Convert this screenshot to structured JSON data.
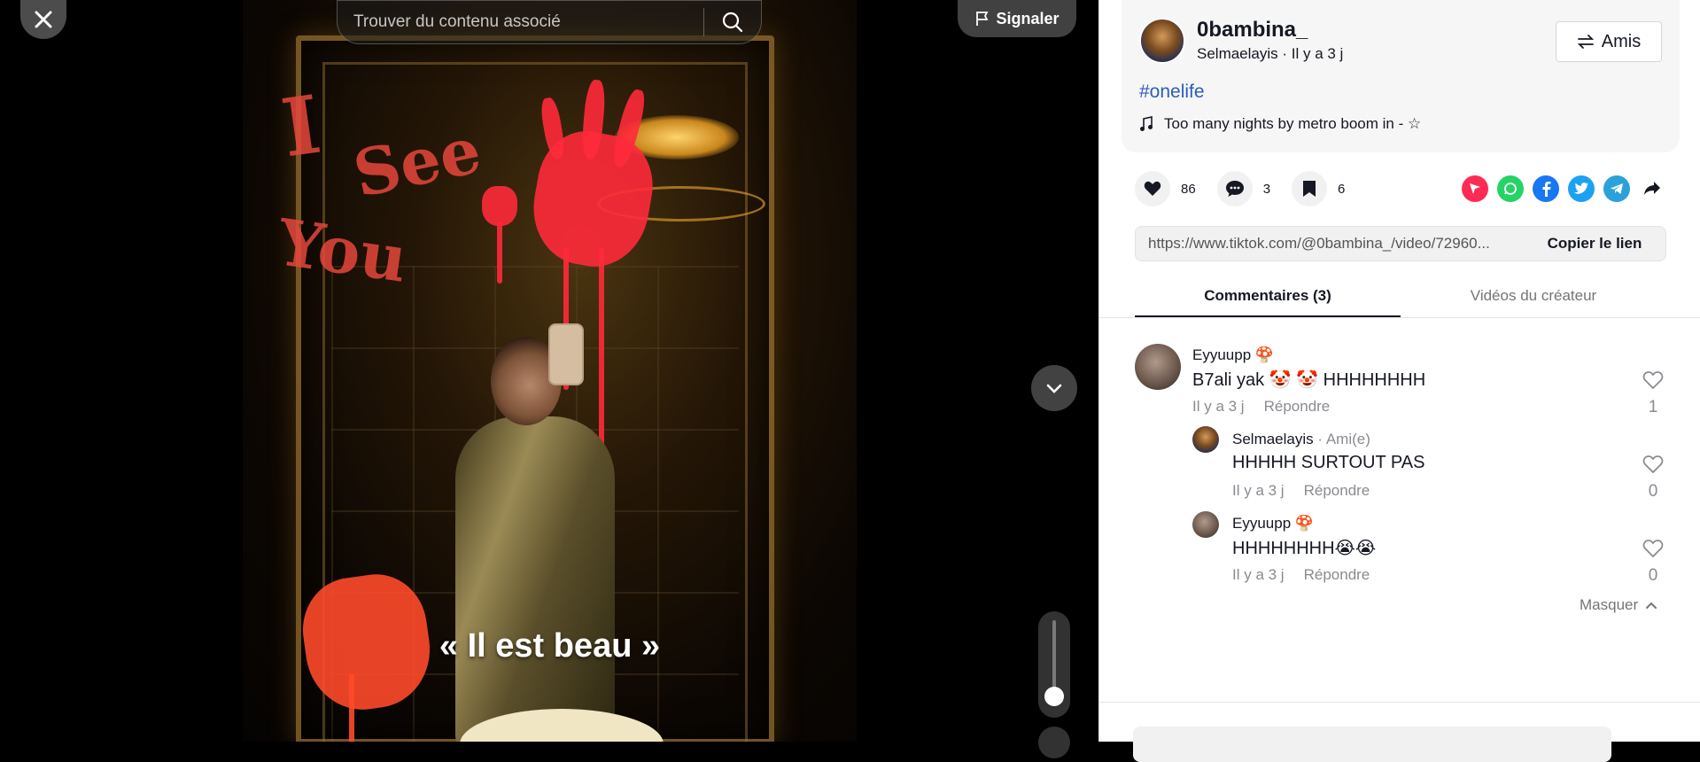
{
  "player": {
    "search_placeholder": "Trouver du contenu associé",
    "report_label": "Signaler",
    "caption": "« Il est beau »",
    "volume_level": 0.05
  },
  "author": {
    "name": "0bambina_",
    "subtitle": "Selmaelayis · Il y a 3 j",
    "friends_label": "Amis",
    "hashtag": "#onelife",
    "music": "Too many nights by metro boom in - ☆"
  },
  "actions": {
    "likes": "86",
    "comments": "3",
    "saves": "6"
  },
  "share_colors": {
    "repost": "#fe2c55",
    "whatsapp": "#25d366",
    "facebook": "#1877f2",
    "twitter": "#1da1f2",
    "telegram": "#2aa1da"
  },
  "link": {
    "url": "https://www.tiktok.com/@0bambina_/video/72960...",
    "copy_label": "Copier le lien"
  },
  "tabs": {
    "comments": "Commentaires (3)",
    "creator_videos": "Vidéos du créateur"
  },
  "comments": [
    {
      "user": "Eyyuupp 🍄",
      "text": "B7ali yak 🤡 🤡 HHHHHHHH",
      "time": "Il y a 3 j",
      "reply": "Répondre",
      "likes": "1"
    },
    {
      "user": "Selmaelayis",
      "friend_tag": " · Ami(e)",
      "text": "HHHHH SURTOUT PAS",
      "time": "Il y a 3 j",
      "reply": "Répondre",
      "likes": "0"
    },
    {
      "user": "Eyyuupp 🍄",
      "text": "HHHHHHHH😭😭",
      "time": "Il y a 3 j",
      "reply": "Répondre",
      "likes": "0"
    }
  ],
  "hide_label": "Masquer"
}
